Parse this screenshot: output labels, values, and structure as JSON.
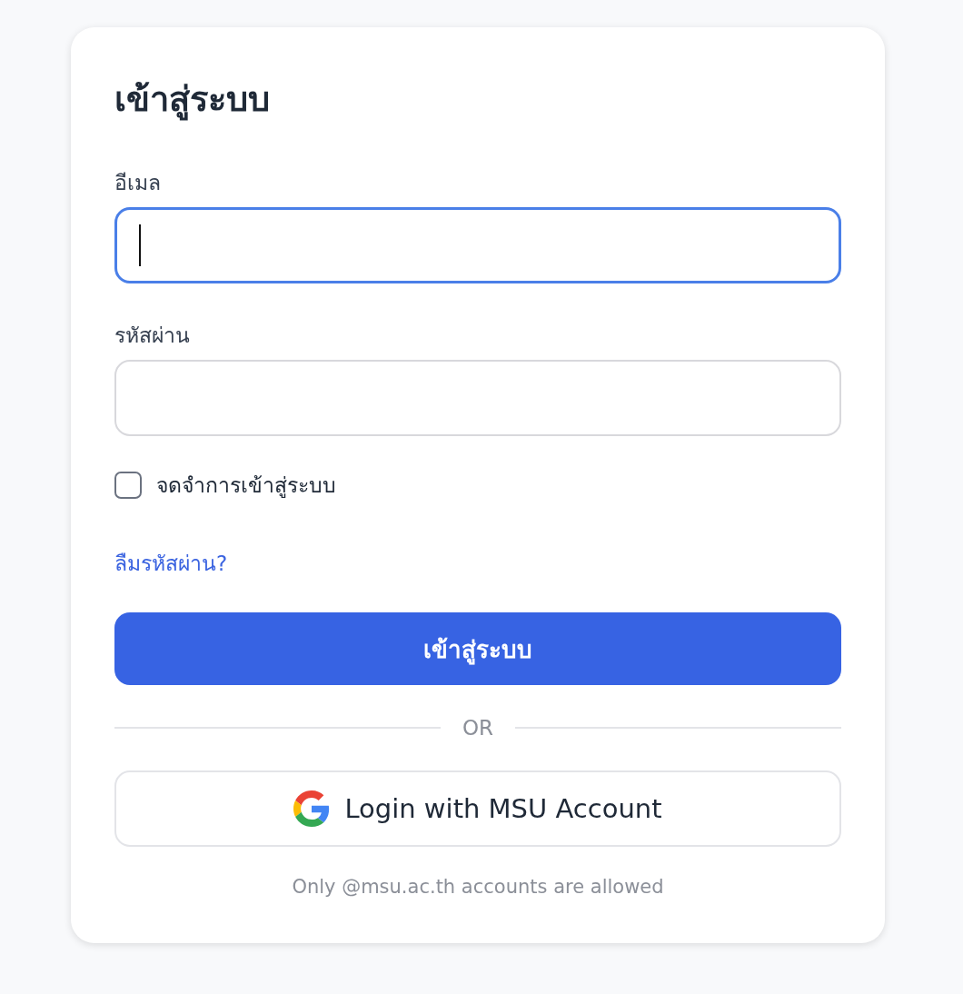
{
  "title": "เข้าสู่ระบบ",
  "fields": [
    {
      "label": "อีเมล",
      "focused": true
    },
    {
      "label": "รหัสผ่าน",
      "focused": false
    }
  ],
  "remember": {
    "label": "จดจำการเข้าสู่ระบบ",
    "checked": false
  },
  "forgot_link": "ลืมรหัสผ่าน?",
  "submit_button": "เข้าสู่ระบบ",
  "divider": "OR",
  "google_button": "Login with MSU Account",
  "footer_note": "Only @msu.ac.th accounts are allowed"
}
